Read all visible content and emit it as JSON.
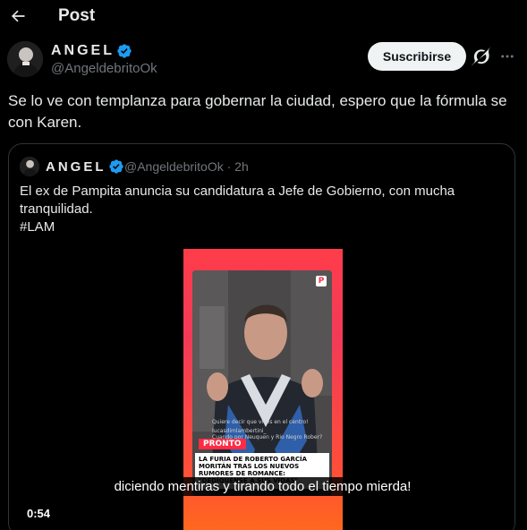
{
  "header": {
    "title": "Post",
    "back_icon": "arrow-left-icon"
  },
  "author": {
    "name": "ANGEL",
    "handle": "@AngeldebritoOk",
    "verified_color": "#1d9bf0",
    "subscribe_label": "Suscribirse",
    "grok_icon": "grok-icon",
    "more_icon": "more-horizontal-icon"
  },
  "post": {
    "text": "Se lo ve con templanza para gobernar la ciudad, espero que la fórmula se con Karen."
  },
  "quote": {
    "name": "ANGEL",
    "handle": "@AngeldebritoOk",
    "time": "· 2h",
    "text_line1": "El ex de Pampita anuncia su candidatura a Jefe de Gobierno, con mucha tranquilidad.",
    "hashtag": "#LAM",
    "video": {
      "subtitle": "diciendo mentiras y tirando todo el tiempo mierda!",
      "duration": "0:54",
      "badge": "PRONTO",
      "logo": "P",
      "headline": "LA FURIA DE ROBERTO GARCÍA MORITÁN TRAS LOS NUEVOS RUMORES DE ROMANCE: \"DEDÍQUENSE A SUS VIDAS\"",
      "comment_top": "Quiere decir que vives en el centro!",
      "comment_user": "lucasdimlambertini_",
      "comment_text": "Cuando por Neuquen y Rio Negro Rober?"
    }
  }
}
